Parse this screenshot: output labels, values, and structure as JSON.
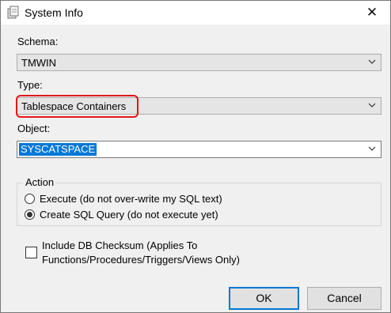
{
  "window": {
    "title": "System Info",
    "close_glyph": "✕",
    "icon": "database-info-icon"
  },
  "schema": {
    "label": "Schema:",
    "value": "TMWIN"
  },
  "type": {
    "label": "Type:",
    "value": "Tablespace Containers"
  },
  "object": {
    "label": "Object:",
    "value": "SYSCATSPACE"
  },
  "action": {
    "legend": "Action",
    "options": [
      {
        "label": "Execute (do not over-write my SQL text)",
        "selected": false
      },
      {
        "label": "Create SQL Query (do not execute yet)",
        "selected": true
      }
    ]
  },
  "checksum": {
    "line1": "Include DB Checksum (Applies To",
    "line2": "Functions/Procedures/Triggers/Views Only)",
    "checked": false
  },
  "buttons": {
    "ok": "OK",
    "cancel": "Cancel"
  },
  "colors": {
    "accent": "#0078d7",
    "highlight": "#e01818"
  }
}
